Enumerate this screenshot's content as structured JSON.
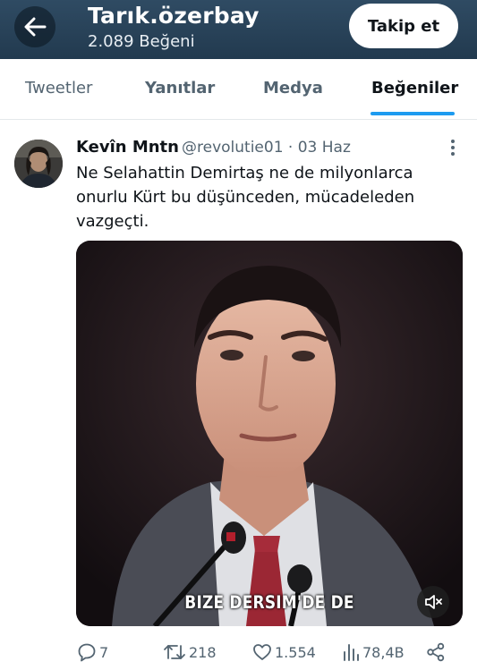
{
  "header": {
    "title": "Tarık.özerbay",
    "subtitle": "2.089 Beğeni",
    "follow_label": "Takip et",
    "back_icon": "arrow-left-icon"
  },
  "tabs": [
    {
      "label": "Tweetler",
      "active": false
    },
    {
      "label": "Yanıtlar",
      "active": false
    },
    {
      "label": "Medya",
      "active": false
    },
    {
      "label": "Beğeniler",
      "active": true
    }
  ],
  "tweet": {
    "author_name": "Kevîn Mntn",
    "handle_date": "@revolutie01 · 03 Haz",
    "text": "Ne Selahattin Demirtaş ne de milyonlarca onurlu Kürt bu düşünceden, mücadeleden vazgeçti.",
    "media": {
      "caption": "BIZE DERSIM'DE DE",
      "mute_icon": "volume-muted-icon"
    },
    "actions": {
      "replies": "7",
      "retweets": "218",
      "likes": "1.554",
      "views": "78,4B"
    }
  },
  "colors": {
    "header_bg": "#2f4b63",
    "accent": "#1d9bf0",
    "secondary_text": "#536471"
  }
}
